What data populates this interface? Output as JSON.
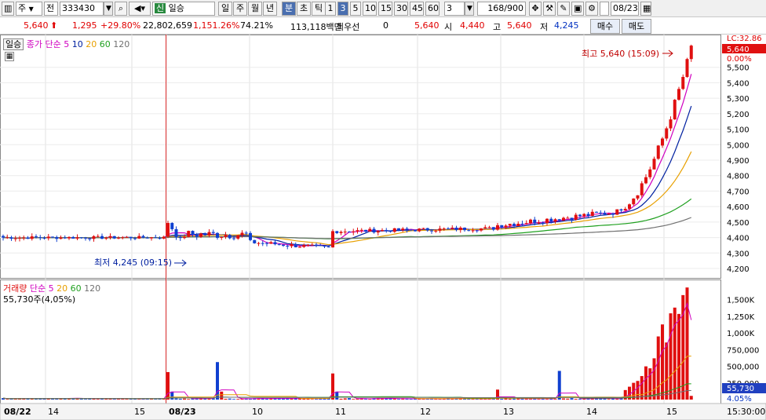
{
  "toolbar": {
    "market": "주",
    "price_type": "전",
    "code": "333430",
    "name_badge": "신",
    "name": "일승",
    "periods": [
      "일",
      "주",
      "월",
      "년",
      "분",
      "초",
      "틱"
    ],
    "active_period": "분",
    "intervals": [
      "1",
      "3",
      "5",
      "10",
      "15",
      "30",
      "45",
      "60"
    ],
    "active_interval": "3",
    "interval_value": "3",
    "count": "168",
    "count_total": "/900",
    "date": "08/23"
  },
  "quote": {
    "price": "5,640",
    "change": "1,295",
    "change_pct": "+29.80%",
    "volume": "22,802,659",
    "volume_ratio": "1,151.26%",
    "turnover": "74.21%",
    "amount": "113,118백만",
    "best_label": "최우선",
    "best_value": "0",
    "best_price": "5,640",
    "open_label": "시",
    "open": "4,440",
    "high_label": "고",
    "high": "5,640",
    "low_label": "저",
    "low": "4,245",
    "buy": "매수",
    "sell": "매도"
  },
  "price_panel": {
    "legend_name": "일승",
    "legend_ma_title": "종가 단순 5",
    "legend_ma": [
      "10",
      "20",
      "60",
      "120"
    ],
    "lc_label": "LC:32.86",
    "current_price": "5,640",
    "current_pct": "0.00%",
    "y_ticks": [
      "5,500",
      "5,400",
      "5,300",
      "5,200",
      "5,100",
      "5,000",
      "4,900",
      "4,800",
      "4,700",
      "4,600",
      "4,500",
      "4,400",
      "4,300",
      "4,200"
    ],
    "high_note": "최고 5,640 (15:09)",
    "low_note": "최저 4,245 (09:15)"
  },
  "volume_panel": {
    "legend_title": "거래량",
    "legend_ma_title": "단순 5",
    "legend_ma": [
      "20",
      "60",
      "120"
    ],
    "current_text": "55,730주(4,05%)",
    "current_value": "55,730",
    "current_pct": "4.05%",
    "y_ticks": [
      "1,500K",
      "1,250K",
      "1,000K",
      "750,000",
      "500,000",
      "250,000"
    ]
  },
  "x_axis": {
    "labels": [
      "08/22",
      "14",
      "15",
      "08/23",
      "10",
      "11",
      "12",
      "13",
      "14",
      "15"
    ],
    "time": "15:30:00"
  },
  "colors": {
    "up": "#e01010",
    "down": "#1040d0",
    "ma5": "#d000c0",
    "ma10": "#0020a0",
    "ma20": "#e8a000",
    "ma60": "#20a020",
    "ma120": "#707070"
  }
}
